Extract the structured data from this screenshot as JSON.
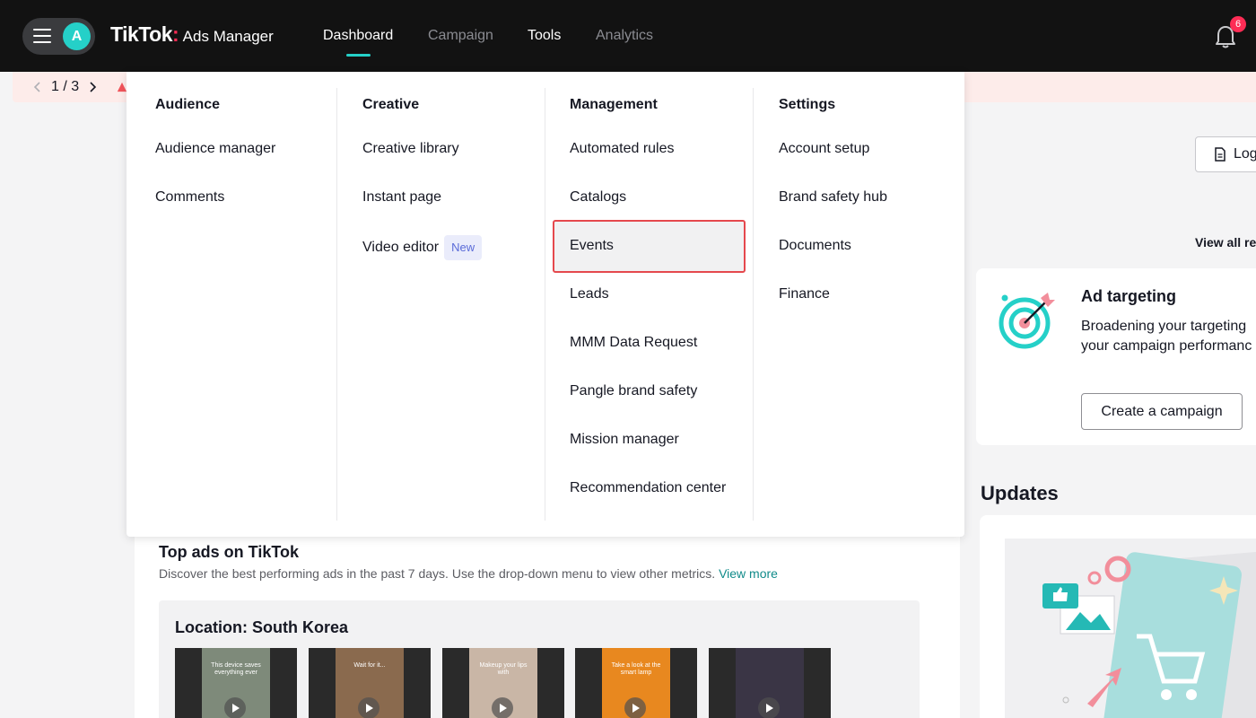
{
  "header": {
    "avatar_letter": "A",
    "brand": "TikTok",
    "brand_colon": ":",
    "product": "Ads Manager",
    "tabs": [
      {
        "label": "Dashboard"
      },
      {
        "label": "Campaign"
      },
      {
        "label": "Tools"
      },
      {
        "label": "Analytics"
      }
    ],
    "active_tab": "Dashboard",
    "notifications_count": "6"
  },
  "notice": {
    "pager": "1 / 3"
  },
  "menu": {
    "columns": [
      {
        "heading": "Audience",
        "items": [
          "Audience manager",
          "Comments"
        ]
      },
      {
        "heading": "Creative",
        "items": [
          "Creative library",
          "Instant page",
          "Video editor"
        ],
        "badge": "New"
      },
      {
        "heading": "Management",
        "items": [
          "Automated rules",
          "Catalogs",
          "Events",
          "Leads",
          "MMM Data Request",
          "Pangle brand safety",
          "Mission manager",
          "Recommendation center"
        ]
      },
      {
        "heading": "Settings",
        "items": [
          "Account setup",
          "Brand safety hub",
          "Documents",
          "Finance"
        ]
      }
    ],
    "highlighted_item": "Events"
  },
  "right_panel": {
    "log_button": "Log",
    "view_all": "View all re",
    "ad_targeting": {
      "title": "Ad targeting",
      "desc_line1": "Broadening your targeting",
      "desc_line2": "your campaign performanc",
      "button": "Create a campaign"
    },
    "updates_title": "Updates"
  },
  "top_ads": {
    "title": "Top ads on TikTok",
    "desc": "Discover the best performing ads in the past 7 days. Use the drop-down menu to view other metrics.",
    "view_more": "View more",
    "location_title": "Location: South Korea",
    "thumbnails": [
      {
        "caption": "This device saves everything ever"
      },
      {
        "caption": "Wait for it..."
      },
      {
        "caption": "Makeup your lips with"
      },
      {
        "caption": "Take a look at the smart lamp"
      },
      {
        "caption": ""
      }
    ]
  },
  "colors": {
    "topbar": "#121212",
    "accent": "#25d0c8",
    "brand_red": "#fe2c55",
    "highlight_border": "#e5484d"
  }
}
